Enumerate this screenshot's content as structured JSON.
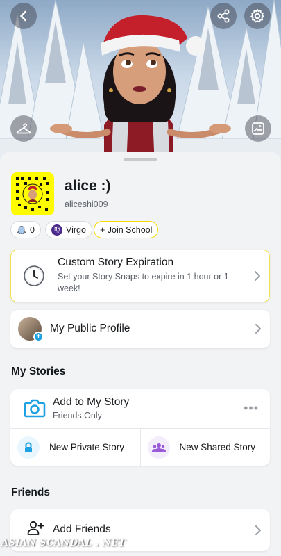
{
  "header": {
    "back_icon": "chevron-left-icon",
    "share_icon": "share-icon",
    "settings_icon": "gear-icon",
    "wardrobe_icon": "hanger-icon",
    "background_icon": "image-icon"
  },
  "profile": {
    "display_name": "alice :)",
    "username": "aliceshi009",
    "friend_score": "0",
    "zodiac": "Virgo",
    "zodiac_glyph": "♍",
    "join_school": "+ Join School"
  },
  "expiry_card": {
    "title": "Custom Story Expiration",
    "subtitle": "Set your Story Snaps to expire in 1 hour or 1 week!"
  },
  "public_profile": {
    "label": "My Public Profile"
  },
  "my_stories": {
    "section_title": "My Stories",
    "add_title": "Add to My Story",
    "add_subtitle": "Friends Only",
    "private_label": "New Private Story",
    "shared_label": "New Shared Story"
  },
  "friends": {
    "section_title": "Friends",
    "add_label": "Add Friends"
  },
  "watermark": "ASIAN SCANDAL . NET",
  "colors": {
    "accent_yellow": "#fffc00",
    "camera_blue": "#1ea1e3",
    "lock_blue": "#1ea1e3",
    "group_purple": "#9a5ad8"
  }
}
